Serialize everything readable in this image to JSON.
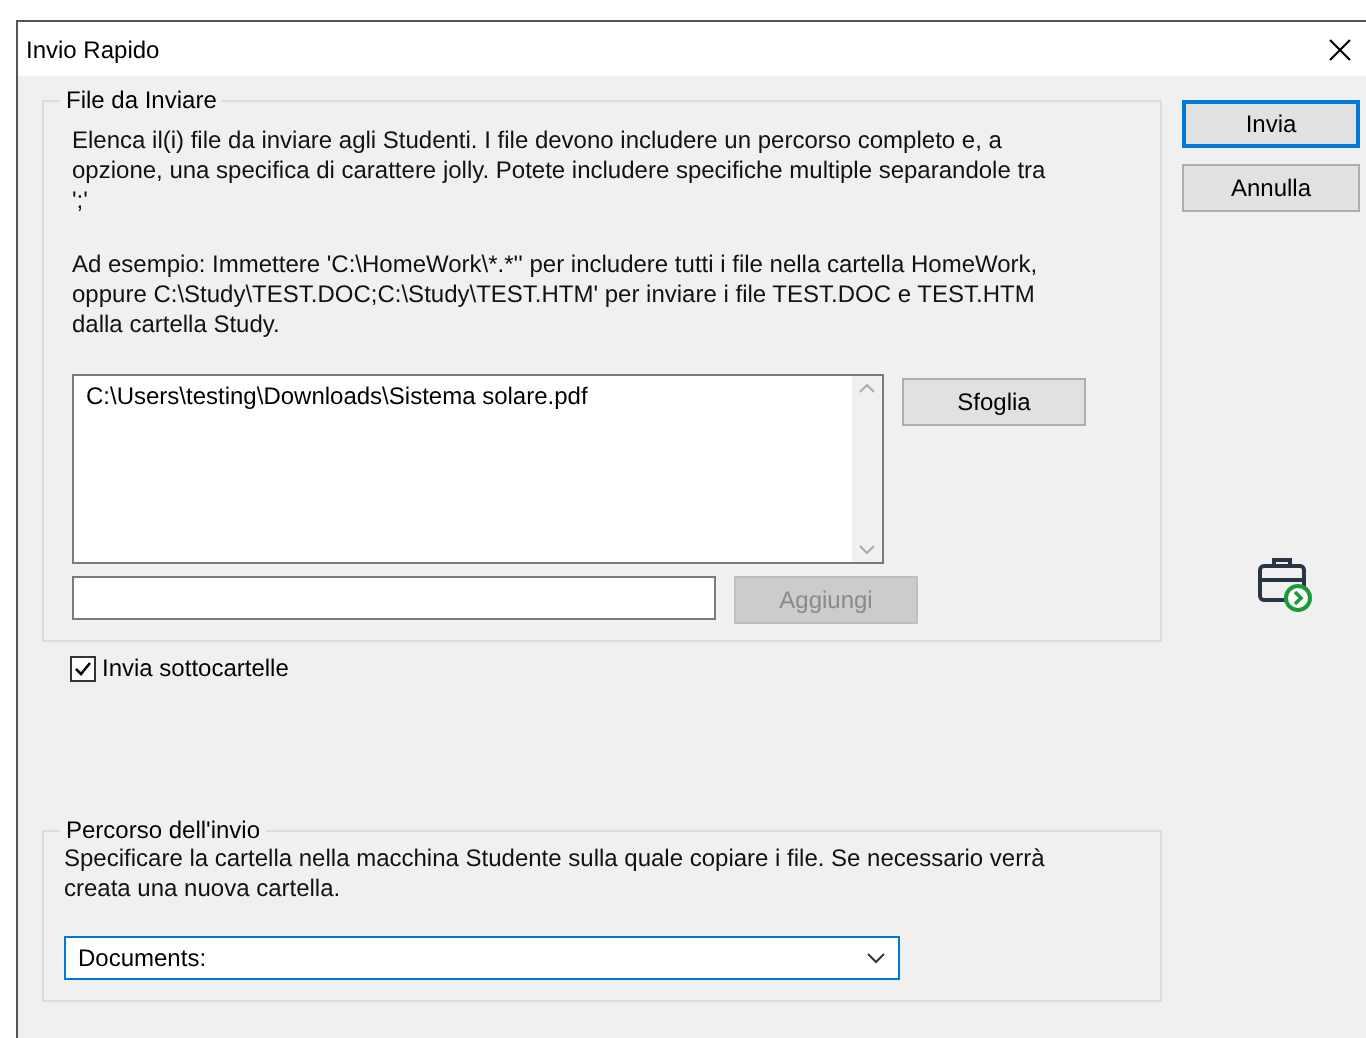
{
  "window": {
    "title": "Invio Rapido"
  },
  "files_group": {
    "title": "File da Inviare",
    "description": "Elenca il(i) file da inviare agli Studenti. I file devono includere un percorso completo e, a opzione, una specifica di carattere jolly. Potete includere specifiche multiple separandole tra ';'",
    "example": "Ad esempio: Immettere 'C:\\HomeWork\\*.*'' per includere tutti i file nella cartella HomeWork, oppure C:\\Study\\TEST.DOC;C:\\Study\\TEST.HTM' per inviare i file TEST.DOC e TEST.HTM dalla cartella Study.",
    "file_list": [
      "C:\\Users\\testing\\Downloads\\Sistema solare.pdf"
    ],
    "browse_button": {
      "label": "Sfoglia",
      "disabled": false
    },
    "add_button": {
      "label": "Aggiungi",
      "disabled": true
    }
  },
  "subfolders_checkbox": {
    "label": "Invia sottocartelle",
    "checked": true
  },
  "destination_group": {
    "title": "Percorso dell'invio",
    "description": "Specificare la cartella nella macchina Studente sulla quale copiare i file. Se necessario verrà creata una nuova cartella.",
    "combo_value": "Documents:"
  },
  "buttons": [
    {
      "label": "Invia",
      "default": true
    },
    {
      "label": "Annulla",
      "default": false
    }
  ]
}
